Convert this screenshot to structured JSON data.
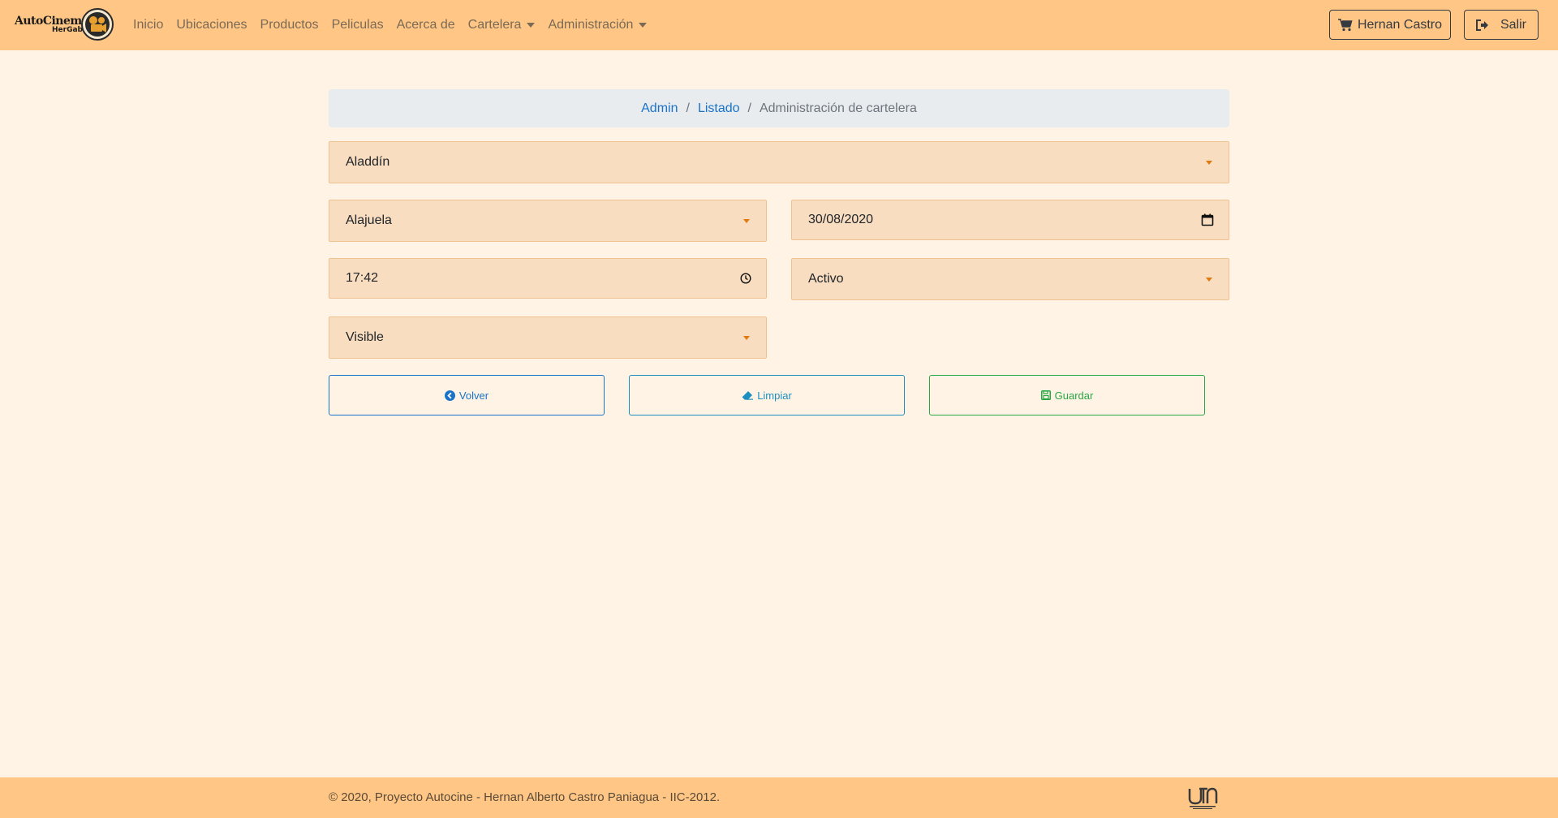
{
  "brand": {
    "line1": "AutoCinema",
    "line2": "HerGab",
    "logo_icon": "film-camera-logo"
  },
  "nav": {
    "items": [
      {
        "label": "Inicio"
      },
      {
        "label": "Ubicaciones"
      },
      {
        "label": "Productos"
      },
      {
        "label": "Peliculas"
      },
      {
        "label": "Acerca de"
      },
      {
        "label": "Cartelera",
        "dropdown": true
      },
      {
        "label": "Administración",
        "dropdown": true
      }
    ],
    "user_button": {
      "label": "Hernan Castro",
      "icon": "cart-icon"
    },
    "exit_button": {
      "label": "Salir",
      "icon": "sign-out-icon"
    }
  },
  "breadcrumb": {
    "items": [
      {
        "label": "Admin",
        "link": true
      },
      {
        "label": "Listado",
        "link": true
      },
      {
        "label": "Administración de cartelera",
        "link": false
      }
    ]
  },
  "form": {
    "movie": {
      "value": "Aladdín"
    },
    "location": {
      "value": "Alajuela"
    },
    "date": {
      "value": "30/08/2020",
      "icon": "calendar-icon"
    },
    "time": {
      "value": "17:42",
      "icon": "clock-icon"
    },
    "state": {
      "value": "Activo"
    },
    "visibility": {
      "value": "Visible"
    }
  },
  "actions": {
    "back": {
      "label": "Volver",
      "icon": "chevron-left-circle-icon"
    },
    "clear": {
      "label": "Limpiar",
      "icon": "eraser-icon"
    },
    "save": {
      "label": "Guardar",
      "icon": "floppy-disk-icon"
    }
  },
  "footer": {
    "text": "© 2020, Proyecto Autocine - Hernan Alberto Castro Paniagua - IIC-2012.",
    "logo": "utn-logo"
  },
  "colors": {
    "navbar": "#ffc685",
    "page_bg": "#fff3e5",
    "field_bg": "#f8ddc0",
    "primary": "#1a73c8",
    "info": "#1b8fc0",
    "success": "#28a745"
  }
}
